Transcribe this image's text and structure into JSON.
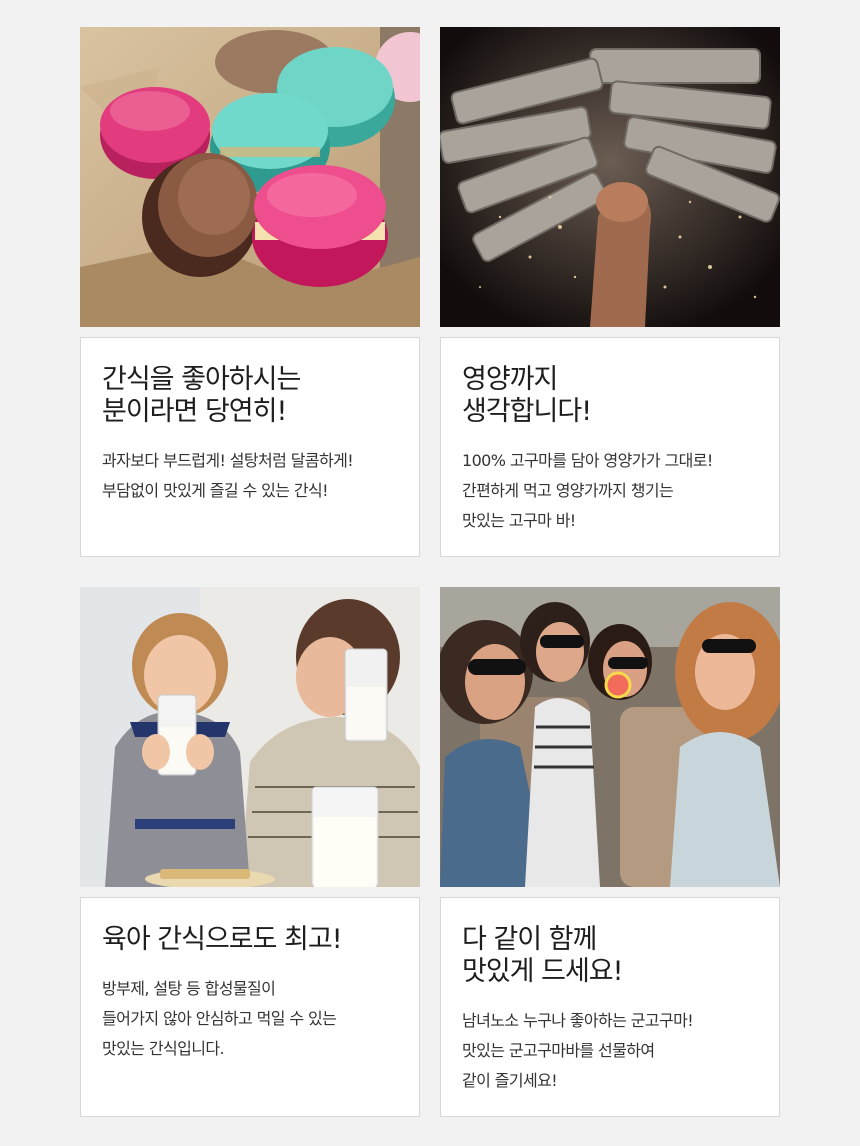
{
  "cards": [
    {
      "image": "macarons-photo",
      "headline": "간식을 좋아하시는\n분이라면 당연히!",
      "body": "과자보다 부드럽게! 설탕처럼 달콤하게!\n부담없이 맛있게 즐길 수 있는 간식!"
    },
    {
      "image": "breaking-bars-photo",
      "headline": "영양까지\n생각합니다!",
      "body": "100% 고구마를 담아 영양가가 그대로!\n간편하게 먹고 영양가까지 챙기는\n맛있는 고구마 바!"
    },
    {
      "image": "mother-daughter-milk-photo",
      "headline": "육아 간식으로도 최고!",
      "body": "방부제, 설탕 등 합성물질이\n들어가지 않아 안심하고 먹일 수 있는\n맛있는 간식입니다."
    },
    {
      "image": "friends-in-car-photo",
      "headline": "다 같이 함께\n맛있게 드세요!",
      "body": "남녀노소 누구나 좋아하는 군고구마!\n맛있는 군고구마바를 선물하여\n같이 즐기세요!"
    }
  ]
}
